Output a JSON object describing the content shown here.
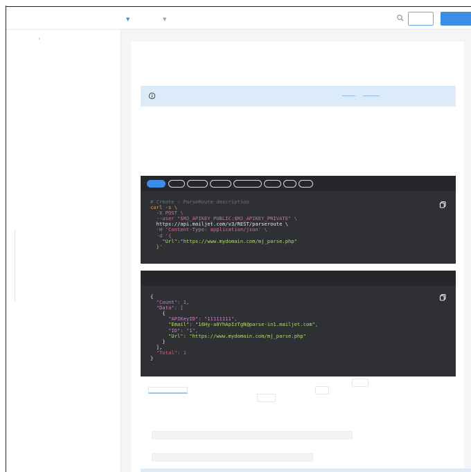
{
  "topbar": {
    "icons": [
      "chevron-down-icon",
      "chevron-down-icon",
      "search-icon"
    ],
    "search_placeholder": "",
    "accent_color": "#3a8ee6"
  },
  "sidebar": {
    "icons": [
      "chevron-right-icon"
    ]
  },
  "info_box": {
    "icon": "info-icon",
    "background": "#dcebfa"
  },
  "request_panel": {
    "tabs": [
      "",
      "",
      "",
      "",
      "",
      "",
      "",
      ""
    ],
    "active_tab": 0,
    "lines": [
      "# Create : ParseRoute description",
      "curl -s \\",
      "  -X POST \\",
      "  --user \"$MJ_APIKEY_PUBLIC:$MJ_APIKEY_PRIVATE\" \\",
      "  https://api.mailjet.com/v3/REST/parseroute \\",
      "  -H 'Content-Type: application/json' \\",
      "  -d '{",
      "    \"Url\":\"https://www.mydomain.com/mj_parse.php\"",
      "  }'"
    ],
    "copy_icon": "copy-icon"
  },
  "response_panel": {
    "lines": [
      "{",
      "  \"Count\": 1,",
      "  \"Data\": [",
      "    {",
      "      \"APIKeyID\": \"11111111\",",
      "      \"Email\": \"16Hy-a0YhApIzTgN@parse-in1.mailjet.com\",",
      "      \"ID\": \"1\",",
      "      \"Url\": \"https://www.mydomain.com/mj_parse.php\"",
      "    }",
      "  ],",
      "  \"Total\": 1",
      "}"
    ],
    "copy_icon": "copy-icon"
  },
  "colors": {
    "code_bg": "#2e3034",
    "code_header": "#25272b",
    "comment": "#6d7178",
    "string": "#b5d96d",
    "key": "#c586c0",
    "number": "#e05d6f",
    "command": "#f2a24b"
  }
}
